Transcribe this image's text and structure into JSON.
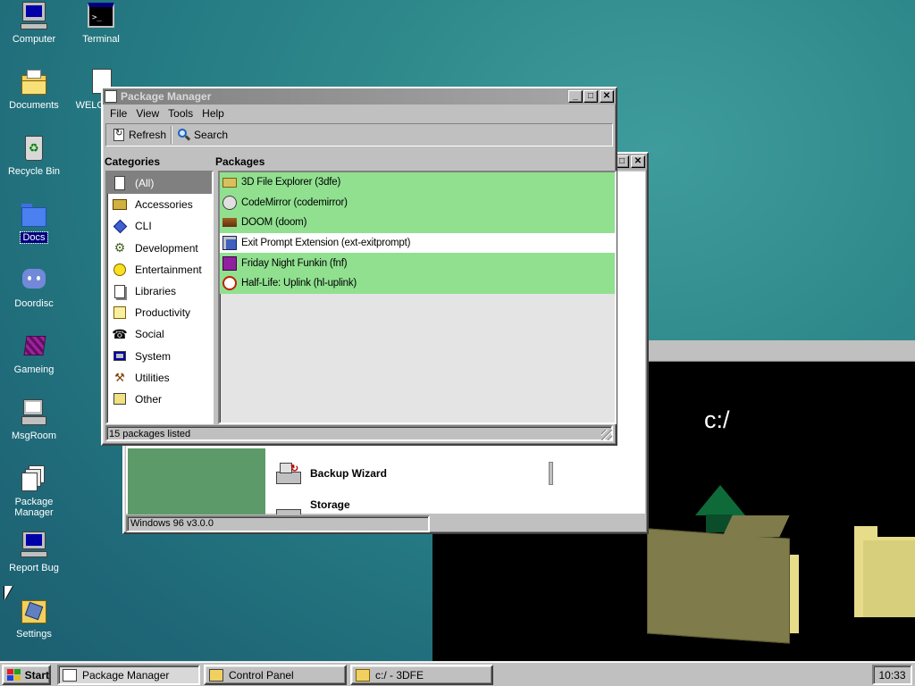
{
  "desktop": {
    "icons": [
      {
        "label": "Computer"
      },
      {
        "label": "Terminal"
      },
      {
        "label": "Documents"
      },
      {
        "label": "WELCOME"
      },
      {
        "label": "Recycle Bin"
      },
      {
        "label": "Docs"
      },
      {
        "label": "Doordisc"
      },
      {
        "label": "Gameing"
      },
      {
        "label": "MsgRoom"
      },
      {
        "label": "Package Manager"
      },
      {
        "label": "Report Bug"
      },
      {
        "label": "Settings"
      }
    ]
  },
  "package_manager": {
    "title": "Package Manager",
    "menu": [
      "File",
      "View",
      "Tools",
      "Help"
    ],
    "toolbar": {
      "refresh": "Refresh",
      "search": "Search"
    },
    "categories_heading": "Categories",
    "packages_heading": "Packages",
    "categories": [
      "(All)",
      "Accessories",
      "CLI",
      "Development",
      "Entertainment",
      "Libraries",
      "Productivity",
      "Social",
      "System",
      "Utilities",
      "Other"
    ],
    "packages": [
      {
        "label": "3D File Explorer (3dfe)",
        "installed": true
      },
      {
        "label": "CodeMirror (codemirror)",
        "installed": true
      },
      {
        "label": "DOOM (doom)",
        "installed": true
      },
      {
        "label": "Exit Prompt Extension (ext-exitprompt)",
        "installed": false
      },
      {
        "label": "Friday Night Funkin (fnf)",
        "installed": true
      },
      {
        "label": "Half-Life: Uplink (hl-uplink)",
        "installed": true
      }
    ],
    "status": "15 packages listed"
  },
  "control_panel": {
    "items": [
      "Backup Wizard",
      "Storage"
    ],
    "status": "Windows 96 v3.0.0"
  },
  "explorer_3d": {
    "path": "c:/"
  },
  "taskbar": {
    "start": "Start",
    "tasks": [
      "Package Manager",
      "Control Panel",
      "c:/ - 3DFE"
    ],
    "clock": "10:33"
  },
  "colors": {
    "installed_row": "#90e090",
    "selection": "#808080",
    "window_face": "#c0c0c0"
  }
}
